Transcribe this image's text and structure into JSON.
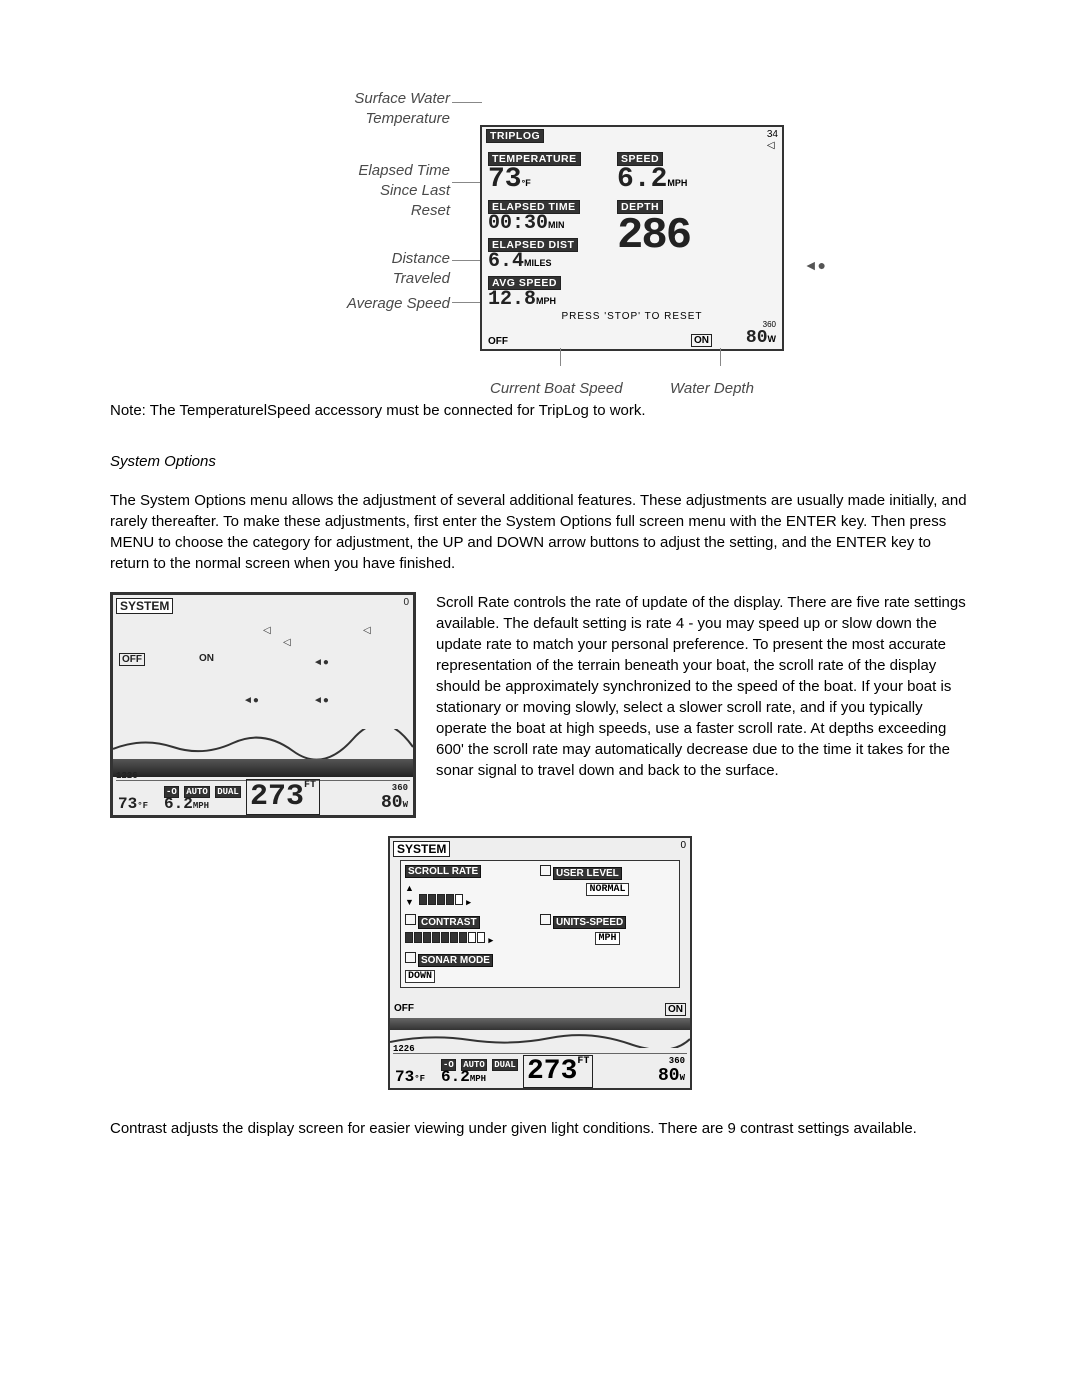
{
  "triplog": {
    "labels": {
      "surface_water": "Surface Water",
      "temperature": "Temperature",
      "elapsed_time": "Elapsed Time",
      "since_last": "Since Last",
      "reset": "Reset",
      "distance": "Distance",
      "traveled": "Traveled",
      "avg_speed": "Average Speed",
      "current_speed": "Current Boat Speed",
      "water_depth": "Water Depth"
    },
    "lcd": {
      "title": "TRIPLOG",
      "temperature_label": "TEMPERATURE",
      "temperature_value": "73",
      "temperature_unit": "°F",
      "speed_label": "SPEED",
      "speed_value": "6.2",
      "speed_unit": "MPH",
      "elapsed_label": "ELAPSED TIME",
      "elapsed_value": "00:30",
      "elapsed_unit": "MIN",
      "depth_label": "DEPTH",
      "depth_value": "286",
      "dist_label": "ELAPSED DIST",
      "dist_value": "6.4",
      "dist_unit": "MILES",
      "avg_label": "AVG SPEED",
      "avg_value": "12.8",
      "avg_unit": "MPH",
      "reset_hint": "PRESS 'STOP' TO RESET",
      "off": "OFF",
      "on": "ON",
      "side_num": "34",
      "range_max": "360",
      "freq": "80",
      "freq_unit": "W"
    }
  },
  "note_text": "Note: The TemperaturelSpeed accessory must be connected for TripLog to work.",
  "system_options_title": "System Options",
  "system_options_para": "The System Options menu allows the adjustment of several additional features. These adjustments are usually made initially, and rarely thereafter. To make these adjustments, first enter the System Options full screen menu with the ENTER key. Then press MENU to choose the category for adjustment, the UP and DOWN arrow buttons to adjust the setting, and the ENTER key to return to the normal screen when you have finished.",
  "scroll_rate_para": "Scroll Rate controls the rate of update of the display. There are five rate settings available. The default setting is rate 4 - you may speed up or slow down the update rate to match your personal preference. To present the most accurate representation of the terrain beneath your boat, the scroll rate of the display should be approximately synchronized to the speed of the boat. If your boat is stationary or moving slowly, select a slower scroll rate, and if you typically operate the boat at high speeds, use a faster scroll rate. At depths exceeding 600' the scroll rate may automatically decrease due to the time it takes for the sonar signal to travel down and back to the surface.",
  "contrast_para": "Contrast adjusts the display screen for easier viewing under given light conditions. There are 9 contrast settings available.",
  "sys_fig": {
    "hdr": "SYSTEM",
    "off": "OFF",
    "on": "ON",
    "zero": "0",
    "line_depth": "1226",
    "auto": "AUTO",
    "dual": "DUAL",
    "io": "-O",
    "depth_big": "273",
    "depth_unit": "FT",
    "temp": "73",
    "temp_unit": "°F",
    "speed": "6.2",
    "speed_unit": "MPH",
    "range_max": "360",
    "freq": "80",
    "freq_unit": "W"
  },
  "opt_fig": {
    "hdr": "SYSTEM",
    "zero": "0",
    "scroll_rate": "SCROLL RATE",
    "user_level": "USER LEVEL",
    "user_level_val": "NORMAL",
    "contrast": "CONTRAST",
    "units_speed": "UNITS-SPEED",
    "units_speed_val": "MPH",
    "sonar_mode": "SONAR MODE",
    "sonar_mode_val": "DOWN",
    "off": "OFF",
    "on": "ON",
    "line_depth": "1226",
    "io": "-O",
    "auto": "AUTO",
    "dual": "DUAL",
    "depth_big": "273",
    "depth_unit": "FT",
    "temp": "73",
    "temp_unit": "°F",
    "speed": "6.2",
    "speed_unit": "MPH",
    "range_max": "360",
    "freq": "80",
    "freq_unit": "W",
    "scroll_slider_filled": 4,
    "scroll_slider_total": 5,
    "contrast_slider_filled": 7,
    "contrast_slider_total": 9
  }
}
